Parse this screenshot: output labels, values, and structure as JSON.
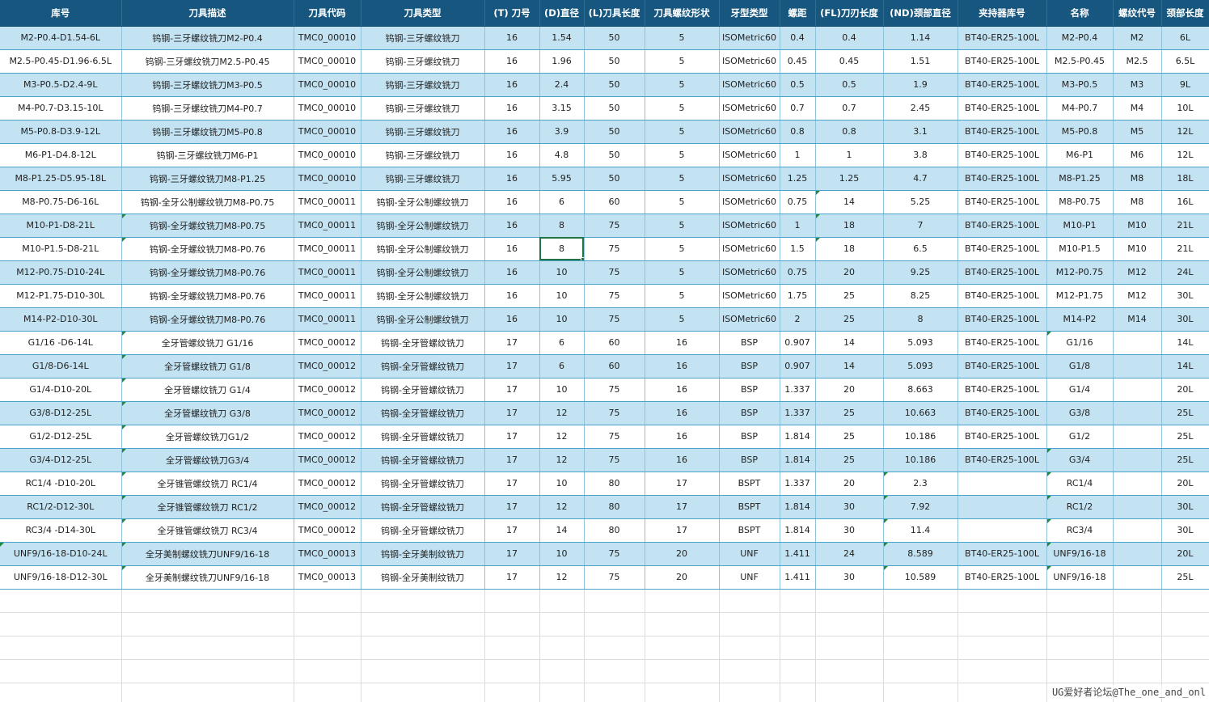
{
  "sheet": {
    "headers": [
      "库号",
      "刀具描述",
      "刀具代码",
      "刀具类型",
      "(T) 刀号",
      "(D)直径",
      "(L)刀具长度",
      "刀具螺纹形状",
      "牙型类型",
      "螺距",
      "(FL)刀刃长度",
      "(ND)颈部直径",
      "夹持器库号",
      "名称",
      "螺纹代号",
      "颈部长度"
    ],
    "rows": [
      [
        "M2-P0.4-D1.54-6L",
        "钨钢-三牙螺纹铣刀M2-P0.4",
        "TMC0_00010",
        "钨钢-三牙螺纹铣刀",
        "16",
        "1.54",
        "50",
        "5",
        "ISOMetric60",
        "0.4",
        "0.4",
        "1.14",
        "BT40-ER25-100L",
        "M2-P0.4",
        "M2",
        "6L"
      ],
      [
        "M2.5-P0.45-D1.96-6.5L",
        "钨钢-三牙螺纹铣刀M2.5-P0.45",
        "TMC0_00010",
        "钨钢-三牙螺纹铣刀",
        "16",
        "1.96",
        "50",
        "5",
        "ISOMetric60",
        "0.45",
        "0.45",
        "1.51",
        "BT40-ER25-100L",
        "M2.5-P0.45",
        "M2.5",
        "6.5L"
      ],
      [
        "M3-P0.5-D2.4-9L",
        "钨钢-三牙螺纹铣刀M3-P0.5",
        "TMC0_00010",
        "钨钢-三牙螺纹铣刀",
        "16",
        "2.4",
        "50",
        "5",
        "ISOMetric60",
        "0.5",
        "0.5",
        "1.9",
        "BT40-ER25-100L",
        "M3-P0.5",
        "M3",
        "9L"
      ],
      [
        "M4-P0.7-D3.15-10L",
        "钨钢-三牙螺纹铣刀M4-P0.7",
        "TMC0_00010",
        "钨钢-三牙螺纹铣刀",
        "16",
        "3.15",
        "50",
        "5",
        "ISOMetric60",
        "0.7",
        "0.7",
        "2.45",
        "BT40-ER25-100L",
        "M4-P0.7",
        "M4",
        "10L"
      ],
      [
        "M5-P0.8-D3.9-12L",
        "钨钢-三牙螺纹铣刀M5-P0.8",
        "TMC0_00010",
        "钨钢-三牙螺纹铣刀",
        "16",
        "3.9",
        "50",
        "5",
        "ISOMetric60",
        "0.8",
        "0.8",
        "3.1",
        "BT40-ER25-100L",
        "M5-P0.8",
        "M5",
        "12L"
      ],
      [
        "M6-P1-D4.8-12L",
        "钨钢-三牙螺纹铣刀M6-P1",
        "TMC0_00010",
        "钨钢-三牙螺纹铣刀",
        "16",
        "4.8",
        "50",
        "5",
        "ISOMetric60",
        "1",
        "1",
        "3.8",
        "BT40-ER25-100L",
        "M6-P1",
        "M6",
        "12L"
      ],
      [
        "M8-P1.25-D5.95-18L",
        "钨钢-三牙螺纹铣刀M8-P1.25",
        "TMC0_00010",
        "钨钢-三牙螺纹铣刀",
        "16",
        "5.95",
        "50",
        "5",
        "ISOMetric60",
        "1.25",
        "1.25",
        "4.7",
        "BT40-ER25-100L",
        "M8-P1.25",
        "M8",
        "18L"
      ],
      [
        "M8-P0.75-D6-16L",
        "钨钢-全牙公制螺纹铣刀M8-P0.75",
        "TMC0_00011",
        "钨钢-全牙公制螺纹铣刀",
        "16",
        "6",
        "60",
        "5",
        "ISOMetric60",
        "0.75",
        "14",
        "5.25",
        "BT40-ER25-100L",
        "M8-P0.75",
        "M8",
        "16L"
      ],
      [
        "M10-P1-D8-21L",
        "钨钢-全牙螺纹铣刀M8-P0.75",
        "TMC0_00011",
        "钨钢-全牙公制螺纹铣刀",
        "16",
        "8",
        "75",
        "5",
        "ISOMetric60",
        "1",
        "18",
        "7",
        "BT40-ER25-100L",
        "M10-P1",
        "M10",
        "21L"
      ],
      [
        "M10-P1.5-D8-21L",
        "钨钢-全牙螺纹铣刀M8-P0.76",
        "TMC0_00011",
        "钨钢-全牙公制螺纹铣刀",
        "16",
        "8",
        "75",
        "5",
        "ISOMetric60",
        "1.5",
        "18",
        "6.5",
        "BT40-ER25-100L",
        "M10-P1.5",
        "M10",
        "21L"
      ],
      [
        "M12-P0.75-D10-24L",
        "钨钢-全牙螺纹铣刀M8-P0.76",
        "TMC0_00011",
        "钨钢-全牙公制螺纹铣刀",
        "16",
        "10",
        "75",
        "5",
        "ISOMetric60",
        "0.75",
        "20",
        "9.25",
        "BT40-ER25-100L",
        "M12-P0.75",
        "M12",
        "24L"
      ],
      [
        "M12-P1.75-D10-30L",
        "钨钢-全牙螺纹铣刀M8-P0.76",
        "TMC0_00011",
        "钨钢-全牙公制螺纹铣刀",
        "16",
        "10",
        "75",
        "5",
        "ISOMetric60",
        "1.75",
        "25",
        "8.25",
        "BT40-ER25-100L",
        "M12-P1.75",
        "M12",
        "30L"
      ],
      [
        "M14-P2-D10-30L",
        "钨钢-全牙螺纹铣刀M8-P0.76",
        "TMC0_00011",
        "钨钢-全牙公制螺纹铣刀",
        "16",
        "10",
        "75",
        "5",
        "ISOMetric60",
        "2",
        "25",
        "8",
        "BT40-ER25-100L",
        "M14-P2",
        "M14",
        "30L"
      ],
      [
        "G1/16 -D6-14L",
        "全牙管螺纹铣刀 G1/16",
        "TMC0_00012",
        "钨钢-全牙管螺纹铣刀",
        "17",
        "6",
        "60",
        "16",
        "BSP",
        "0.907",
        "14",
        "5.093",
        "BT40-ER25-100L",
        "G1/16",
        "",
        "14L"
      ],
      [
        "G1/8-D6-14L",
        "全牙管螺纹铣刀 G1/8",
        "TMC0_00012",
        "钨钢-全牙管螺纹铣刀",
        "17",
        "6",
        "60",
        "16",
        "BSP",
        "0.907",
        "14",
        "5.093",
        "BT40-ER25-100L",
        "G1/8",
        "",
        "14L"
      ],
      [
        "G1/4-D10-20L",
        "全牙管螺纹铣刀 G1/4",
        "TMC0_00012",
        "钨钢-全牙管螺纹铣刀",
        "17",
        "10",
        "75",
        "16",
        "BSP",
        "1.337",
        "20",
        "8.663",
        "BT40-ER25-100L",
        "G1/4",
        "",
        "20L"
      ],
      [
        "G3/8-D12-25L",
        "全牙管螺纹铣刀 G3/8",
        "TMC0_00012",
        "钨钢-全牙管螺纹铣刀",
        "17",
        "12",
        "75",
        "16",
        "BSP",
        "1.337",
        "25",
        "10.663",
        "BT40-ER25-100L",
        "G3/8",
        "",
        "25L"
      ],
      [
        "G1/2-D12-25L",
        "全牙管螺纹铣刀G1/2",
        "TMC0_00012",
        "钨钢-全牙管螺纹铣刀",
        "17",
        "12",
        "75",
        "16",
        "BSP",
        "1.814",
        "25",
        "10.186",
        "BT40-ER25-100L",
        "G1/2",
        "",
        "25L"
      ],
      [
        "G3/4-D12-25L",
        "全牙管螺纹铣刀G3/4",
        "TMC0_00012",
        "钨钢-全牙管螺纹铣刀",
        "17",
        "12",
        "75",
        "16",
        "BSP",
        "1.814",
        "25",
        "10.186",
        "BT40-ER25-100L",
        "G3/4",
        "",
        "25L"
      ],
      [
        "RC1/4 -D10-20L",
        "全牙锥管螺纹铣刀 RC1/4",
        "TMC0_00012",
        "钨钢-全牙管螺纹铣刀",
        "17",
        "10",
        "80",
        "17",
        "BSPT",
        "1.337",
        "20",
        "2.3",
        "",
        "RC1/4",
        "",
        "20L"
      ],
      [
        "RC1/2-D12-30L",
        "全牙锥管螺纹铣刀 RC1/2",
        "TMC0_00012",
        "钨钢-全牙管螺纹铣刀",
        "17",
        "12",
        "80",
        "17",
        "BSPT",
        "1.814",
        "30",
        "7.92",
        "",
        "RC1/2",
        "",
        "30L"
      ],
      [
        "RC3/4 -D14-30L",
        "全牙锥管螺纹铣刀 RC3/4",
        "TMC0_00012",
        "钨钢-全牙管螺纹铣刀",
        "17",
        "14",
        "80",
        "17",
        "BSPT",
        "1.814",
        "30",
        "11.4",
        "",
        "RC3/4",
        "",
        "30L"
      ],
      [
        "UNF9/16-18-D10-24L",
        "全牙美制螺纹铣刀UNF9/16-18",
        "TMC0_00013",
        "钨钢-全牙美制纹铣刀",
        "17",
        "10",
        "75",
        "20",
        "UNF",
        "1.411",
        "24",
        "8.589",
        "BT40-ER25-100L",
        "UNF9/16-18",
        "",
        "20L"
      ],
      [
        "UNF9/16-18-D12-30L",
        "全牙美制螺纹铣刀UNF9/16-18",
        "TMC0_00013",
        "钨钢-全牙美制纹铣刀",
        "17",
        "12",
        "75",
        "20",
        "UNF",
        "1.411",
        "30",
        "10.589",
        "BT40-ER25-100L",
        "UNF9/16-18",
        "",
        "25L"
      ]
    ],
    "empty_rows": 5,
    "selected_cell": {
      "row": 9,
      "col": 5
    },
    "colors": {
      "header_bg": "#17577f",
      "band_bg": "#c3e3f3",
      "selection": "#217346",
      "comment_marker": "#1c8a3a"
    }
  },
  "watermark": "UG爱好者论坛@The_one_and_onl"
}
